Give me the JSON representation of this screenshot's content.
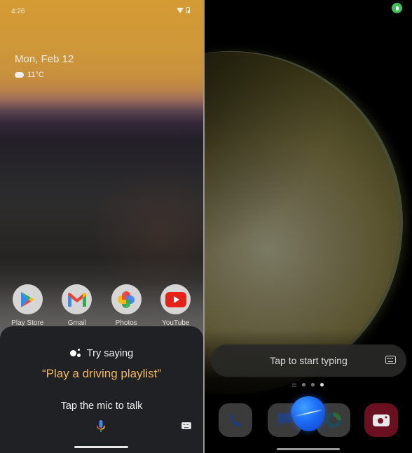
{
  "left_phone": {
    "status_bar": {
      "time": "4:26",
      "icons": [
        "wifi-icon",
        "battery-icon"
      ]
    },
    "glance": {
      "date": "Mon, Feb 12",
      "weather_icon": "partly-cloudy-icon",
      "temperature": "11°C"
    },
    "apps": [
      {
        "label": "Play Store",
        "icon": "play-store-icon"
      },
      {
        "label": "Gmail",
        "icon": "gmail-icon"
      },
      {
        "label": "Photos",
        "icon": "photos-icon"
      },
      {
        "label": "YouTube",
        "icon": "youtube-icon"
      }
    ],
    "assistant": {
      "header_icon": "google-assistant-icon",
      "header": "Try saying",
      "suggestion": "“Play a driving playlist”",
      "prompt": "Tap the mic to talk",
      "mic_icon": "mic-icon",
      "keyboard_icon": "keyboard-icon",
      "suggestion_color": "#f0b862"
    }
  },
  "right_phone": {
    "status_bar": {
      "mic_indicator_color": "#3ec15a"
    },
    "bixby": {
      "input_placeholder": "Tap to start typing",
      "keyboard_icon": "keyboard-icon",
      "page_count": 3,
      "active_page": 3
    },
    "dock": [
      {
        "icon": "phone-icon"
      },
      {
        "icon": "messages-icon"
      },
      {
        "icon": "edge-browser-icon"
      },
      {
        "icon": "camera-icon"
      }
    ]
  }
}
